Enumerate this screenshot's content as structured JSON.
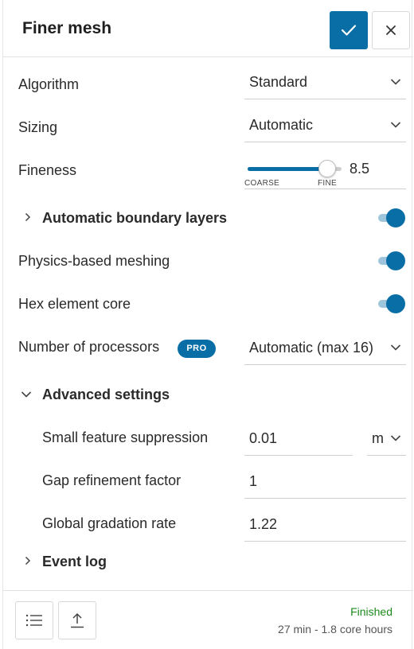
{
  "header": {
    "title": "Finer mesh"
  },
  "algorithm": {
    "label": "Algorithm",
    "value": "Standard"
  },
  "sizing": {
    "label": "Sizing",
    "value": "Automatic"
  },
  "fineness": {
    "label": "Fineness",
    "value": "8.5",
    "min_label": "COARSE",
    "max_label": "FINE",
    "level_fraction": 0.85
  },
  "boundary_layers": {
    "label": "Automatic boundary layers",
    "enabled": true
  },
  "physics_meshing": {
    "label": "Physics-based meshing",
    "enabled": true
  },
  "hex_core": {
    "label": "Hex element core",
    "enabled": true
  },
  "processors": {
    "label": "Number of processors",
    "badge": "PRO",
    "value": "Automatic (max 16)"
  },
  "advanced": {
    "label": "Advanced settings",
    "small_feature": {
      "label": "Small feature suppression",
      "value": "0.01",
      "unit": "m"
    },
    "gap_refinement": {
      "label": "Gap refinement factor",
      "value": "1"
    },
    "gradation": {
      "label": "Global gradation rate",
      "value": "1.22"
    }
  },
  "event_log": {
    "label": "Event log"
  },
  "footer": {
    "status": "Finished",
    "duration": "27 min - 1.8 core hours"
  },
  "colors": {
    "accent": "#0a6ea6",
    "status_green": "#1e8a1e"
  }
}
